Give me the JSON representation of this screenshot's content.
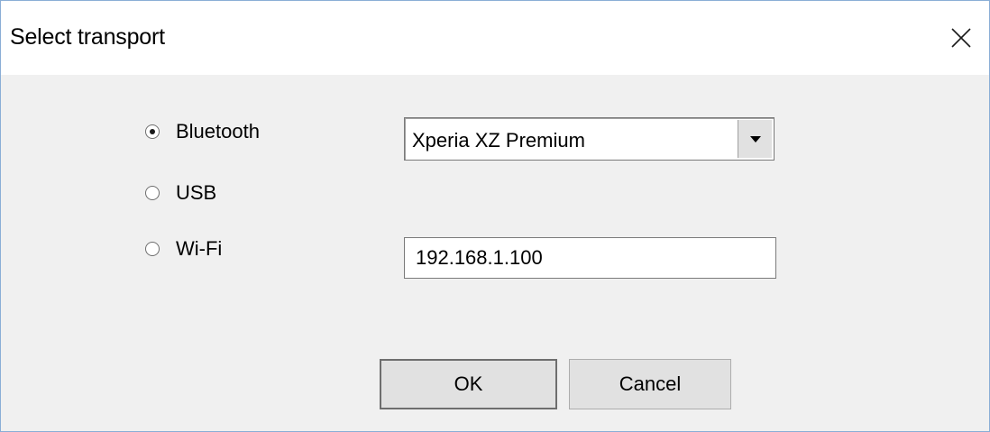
{
  "window": {
    "title": "Select transport",
    "close_icon": "close-icon"
  },
  "transports": {
    "options": [
      {
        "label": "Bluetooth",
        "selected": true
      },
      {
        "label": "USB",
        "selected": false
      },
      {
        "label": "Wi-Fi",
        "selected": false
      }
    ]
  },
  "bluetooth_device": {
    "selected_value": "Xperia XZ Premium",
    "dropdown_icon": "chevron-down-icon"
  },
  "wifi_address": {
    "value": "192.168.1.100"
  },
  "buttons": {
    "ok_label": "OK",
    "cancel_label": "Cancel"
  },
  "colors": {
    "window_border": "#8aaed6",
    "dialog_background": "#f0f0f0",
    "button_face": "#e1e1e1"
  }
}
